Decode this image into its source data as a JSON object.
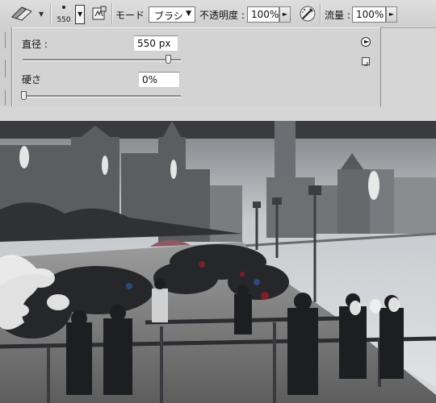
{
  "toolbar": {
    "tool_icon": "eraser-icon",
    "brush_size": "550",
    "mode_label": "モード :",
    "mode_value": "ブラシ",
    "opacity_label": "不透明度 :",
    "opacity_value": "100%",
    "airbrush_icon": "airbrush-icon",
    "flow_label": "流量 :",
    "flow_value": "100%",
    "toggle_panel_icon": "brush-panel-icon"
  },
  "brush_panel": {
    "diameter_label": "直径 :",
    "diameter_value": "550 px",
    "diameter_fraction": 0.92,
    "hardness_label": "硬さ",
    "hardness_value": "0%",
    "hardness_fraction": 0,
    "menu_icon": "panel-menu-arrow-icon",
    "new_preset_icon": "new-preset-icon"
  },
  "canvas": {
    "description_icon": "photo-canvas",
    "colors": {
      "sky": "#c9ccd0",
      "water": "#cfd3d6",
      "crowd": "#2a2a2e",
      "erased": "#f2f2f2"
    }
  }
}
